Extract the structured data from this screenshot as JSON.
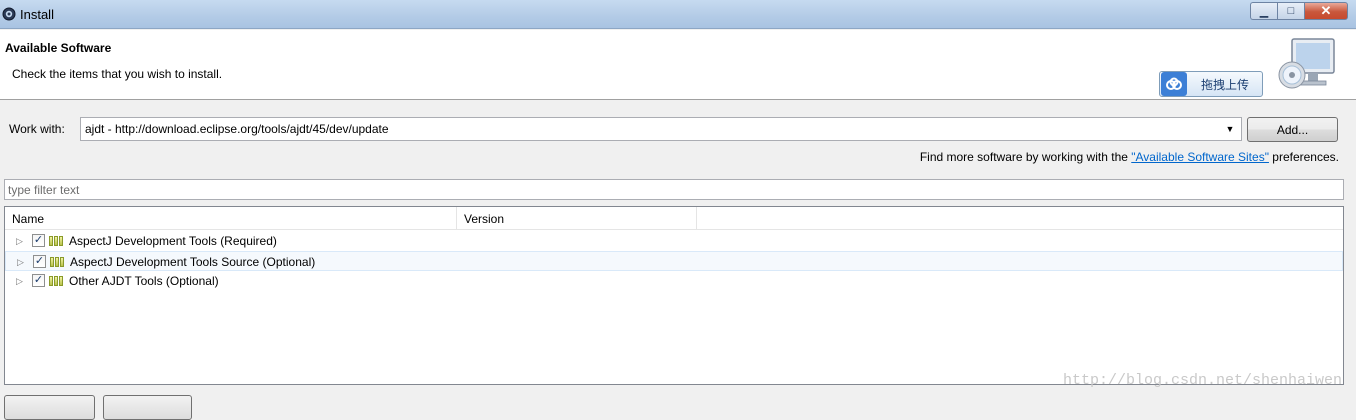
{
  "window": {
    "title": "Install",
    "controls": {
      "minimize": "▁",
      "maximize": "□",
      "close": "✕"
    }
  },
  "header": {
    "title": "Available Software",
    "description": "Check the items that you wish to install.",
    "upload_button": "拖拽上传"
  },
  "work_with": {
    "label": "Work with:",
    "value": "ajdt - http://download.eclipse.org/tools/ajdt/45/dev/update",
    "add_button": "Add..."
  },
  "find_more": {
    "prefix": "Find more software by working with the ",
    "link": "\"Available Software Sites\"",
    "suffix": " preferences."
  },
  "filter": {
    "placeholder": "type filter text"
  },
  "tree": {
    "columns": [
      "Name",
      "Version"
    ],
    "rows": [
      {
        "label": "AspectJ Development Tools (Required)",
        "checked": true,
        "expander": "▷"
      },
      {
        "label": "AspectJ Development Tools Source (Optional)",
        "checked": true,
        "expander": "▷"
      },
      {
        "label": "Other AJDT Tools (Optional)",
        "checked": true,
        "expander": "▷"
      }
    ]
  },
  "watermark": "http://blog.csdn.net/shenhaiwen",
  "icons": {
    "app": "eclipse-gear-icon",
    "expander": "triangle-right-icon",
    "checkbox": "check-icon",
    "package": "package-icon",
    "cloud": "cloud-upload-icon",
    "banner": "computer-cd-icon"
  },
  "colors": {
    "link": "#0066cc",
    "titlebar": "#b3cbe6",
    "accent": "#3c7fd6"
  }
}
